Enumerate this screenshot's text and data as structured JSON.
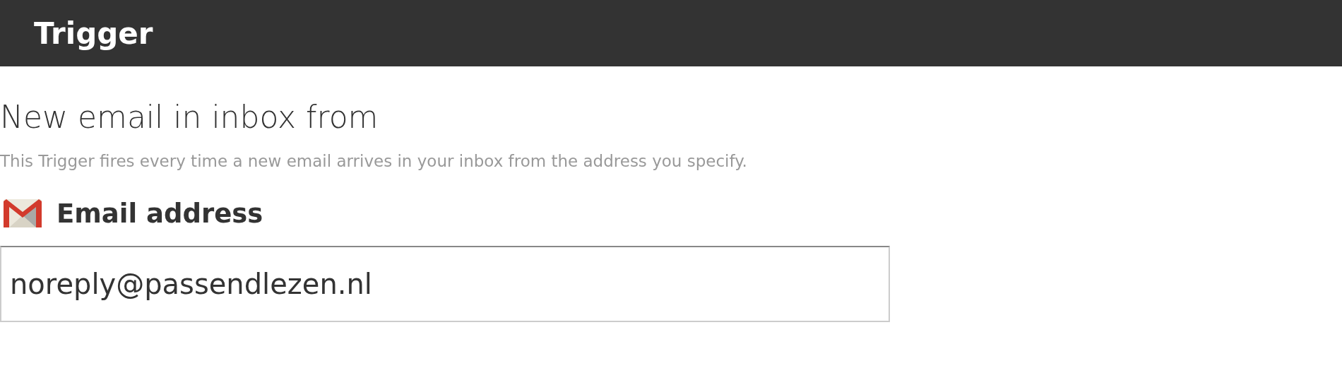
{
  "header": {
    "title": "Trigger"
  },
  "trigger": {
    "title": "New email in inbox from",
    "description": "This Trigger fires every time a new email arrives in your inbox from the address you specify."
  },
  "field": {
    "label": "Email address",
    "value": "noreply@passendlezen.nl"
  }
}
